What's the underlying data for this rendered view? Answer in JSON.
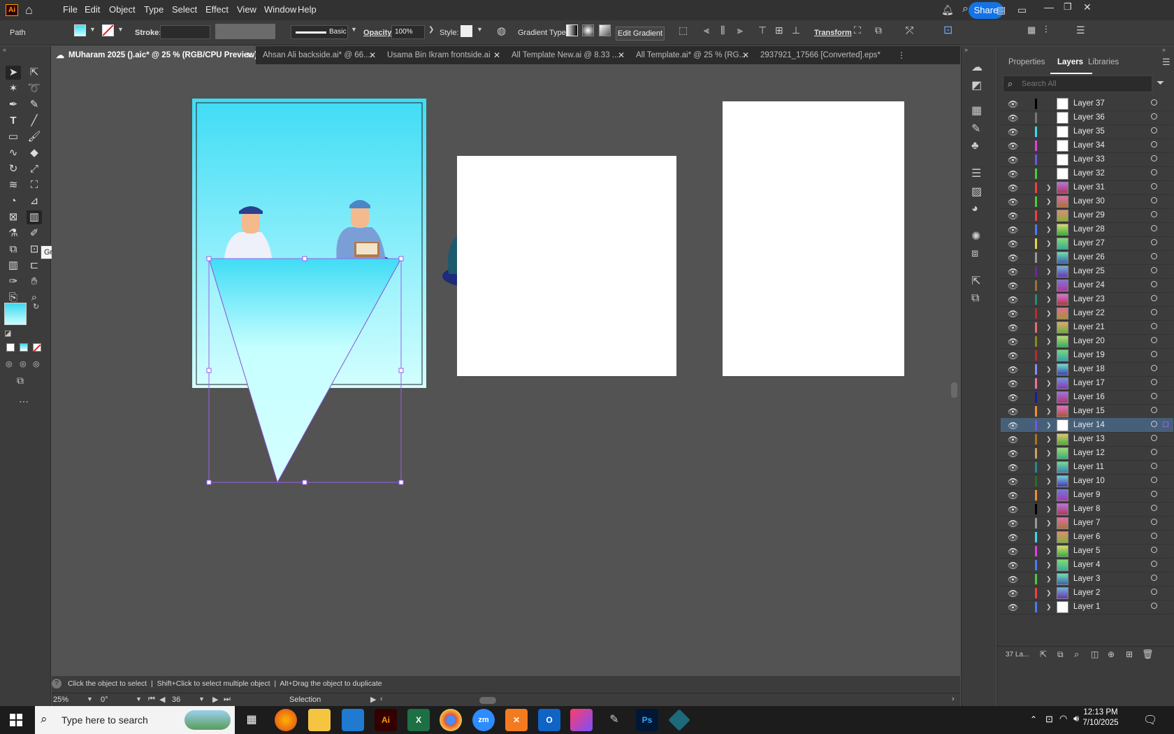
{
  "app": {
    "logo": "Ai"
  },
  "menu": [
    "File",
    "Edit",
    "Object",
    "Type",
    "Select",
    "Effect",
    "View",
    "Window",
    "Help"
  ],
  "share_label": "Share",
  "control": {
    "object_type": "Path",
    "stroke_label": "Stroke:",
    "brush_label": "Basic",
    "opacity_label": "Opacity:",
    "opacity_value": "100%",
    "style_label": "Style:",
    "gradient_type_label": "Gradient Type:",
    "edit_gradient": "Edit Gradient",
    "transform": "Transform"
  },
  "tabs": [
    {
      "label": "MUharam 2025 ().aic* @ 25 % (RGB/CPU Preview)",
      "active": true
    },
    {
      "label": "Ahsan Ali backside.ai* @ 66....",
      "active": false
    },
    {
      "label": "Usama Bin Ikram frontside.ai",
      "active": false
    },
    {
      "label": "All Template New.ai @ 8.33 ...",
      "active": false
    },
    {
      "label": "All Template.ai* @ 25 % (RG...",
      "active": false
    },
    {
      "label": "2937921_17566 [Converted].eps*",
      "active": false
    }
  ],
  "tooltip": "Gradient Tool (G)",
  "panel": {
    "tabs": [
      "Properties",
      "Layers",
      "Libraries"
    ],
    "search_placeholder": "Search All",
    "footer_count": "37 La..."
  },
  "layers": [
    {
      "name": "Layer 37",
      "color": "#000000",
      "expand": false,
      "thumb": "white"
    },
    {
      "name": "Layer 36",
      "color": "#777777",
      "expand": false,
      "thumb": "white"
    },
    {
      "name": "Layer 35",
      "color": "#3fd7f0",
      "expand": false,
      "thumb": "white"
    },
    {
      "name": "Layer 34",
      "color": "#e040e0",
      "expand": false,
      "thumb": "white"
    },
    {
      "name": "Layer 33",
      "color": "#6a5ae0",
      "expand": false,
      "thumb": "white"
    },
    {
      "name": "Layer 32",
      "color": "#4ec93f",
      "expand": false,
      "thumb": "white"
    },
    {
      "name": "Layer 31",
      "color": "#f04040",
      "expand": true,
      "thumb": "img"
    },
    {
      "name": "Layer 30",
      "color": "#4ec93f",
      "expand": true,
      "thumb": "img"
    },
    {
      "name": "Layer 29",
      "color": "#f04040",
      "expand": true,
      "thumb": "img"
    },
    {
      "name": "Layer 28",
      "color": "#4a7cf0",
      "expand": true,
      "thumb": "img"
    },
    {
      "name": "Layer 27",
      "color": "#f0d040",
      "expand": true,
      "thumb": "img"
    },
    {
      "name": "Layer 26",
      "color": "#999999",
      "expand": true,
      "thumb": "img"
    },
    {
      "name": "Layer 25",
      "color": "#6a2a9a",
      "expand": true,
      "thumb": "img"
    },
    {
      "name": "Layer 24",
      "color": "#a07030",
      "expand": true,
      "thumb": "img"
    },
    {
      "name": "Layer 23",
      "color": "#2a8a6a",
      "expand": true,
      "thumb": "img"
    },
    {
      "name": "Layer 22",
      "color": "#b03030",
      "expand": true,
      "thumb": "img"
    },
    {
      "name": "Layer 21",
      "color": "#e07070",
      "expand": true,
      "thumb": "img"
    },
    {
      "name": "Layer 20",
      "color": "#8a8a20",
      "expand": true,
      "thumb": "img"
    },
    {
      "name": "Layer 19",
      "color": "#b03030",
      "expand": true,
      "thumb": "img"
    },
    {
      "name": "Layer 18",
      "color": "#8a8af0",
      "expand": true,
      "thumb": "img"
    },
    {
      "name": "Layer 17",
      "color": "#f070a0",
      "expand": true,
      "thumb": "img"
    },
    {
      "name": "Layer 16",
      "color": "#1a1a9a",
      "expand": true,
      "thumb": "img"
    },
    {
      "name": "Layer 15",
      "color": "#f09030",
      "expand": true,
      "thumb": "img"
    },
    {
      "name": "Layer 14",
      "color": "#6a5ae0",
      "expand": true,
      "thumb": "white",
      "selected": true
    },
    {
      "name": "Layer 13",
      "color": "#b07020",
      "expand": true,
      "thumb": "img"
    },
    {
      "name": "Layer 12",
      "color": "#d0a060",
      "expand": true,
      "thumb": "img"
    },
    {
      "name": "Layer 11",
      "color": "#2a8a8a",
      "expand": true,
      "thumb": "img"
    },
    {
      "name": "Layer 10",
      "color": "#2a6a2a",
      "expand": true,
      "thumb": "img"
    },
    {
      "name": "Layer 9",
      "color": "#f09030",
      "expand": true,
      "thumb": "img"
    },
    {
      "name": "Layer 8",
      "color": "#000000",
      "expand": true,
      "thumb": "img"
    },
    {
      "name": "Layer 7",
      "color": "#999999",
      "expand": true,
      "thumb": "img"
    },
    {
      "name": "Layer 6",
      "color": "#3fd7f0",
      "expand": true,
      "thumb": "img"
    },
    {
      "name": "Layer 5",
      "color": "#e040e0",
      "expand": true,
      "thumb": "img"
    },
    {
      "name": "Layer 4",
      "color": "#4a7cf0",
      "expand": true,
      "thumb": "img"
    },
    {
      "name": "Layer 3",
      "color": "#4ec93f",
      "expand": true,
      "thumb": "img"
    },
    {
      "name": "Layer 2",
      "color": "#f04040",
      "expand": true,
      "thumb": "img"
    },
    {
      "name": "Layer 1",
      "color": "#4a7cf0",
      "expand": true,
      "thumb": "white"
    }
  ],
  "status": {
    "hint": "Click the object to select  |  Shift+Click to select multiple object  |  Alt+Drag the object to duplicate",
    "zoom": "25%",
    "rotate": "0°",
    "artboard": "36",
    "mode": "Selection"
  },
  "taskbar": {
    "search_placeholder": "Type here to search",
    "time": "12:13 PM",
    "date": "7/10/2025"
  },
  "colors": {
    "accent": "#1473e6",
    "gradient_top": "#3fd7f0",
    "gradient_bottom": "#c9ffff"
  }
}
